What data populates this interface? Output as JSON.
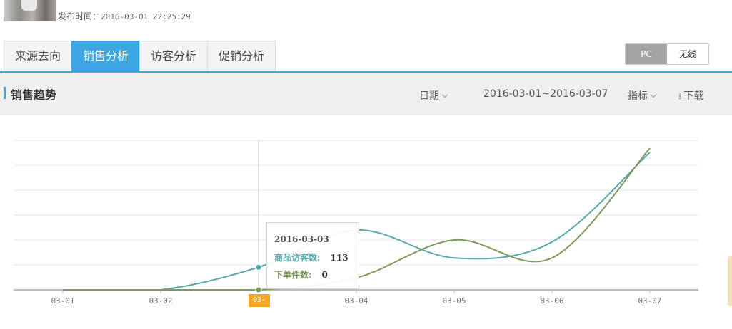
{
  "header": {
    "pubtime_label": "发布时间：",
    "pubtime_value": "2016-03-01 22:25:29"
  },
  "tabs": [
    {
      "label": "来源去向",
      "active": false
    },
    {
      "label": "销售分析",
      "active": true
    },
    {
      "label": "访客分析",
      "active": false
    },
    {
      "label": "促销分析",
      "active": false
    }
  ],
  "device_toggle": {
    "pc": "PC",
    "wireless": "无线",
    "selected": "PC"
  },
  "section": {
    "title": "销售趋势",
    "date_dropdown": "日期",
    "date_range": "2016-03-01~2016-03-07",
    "metric_dropdown": "指标",
    "download": "下载"
  },
  "colors": {
    "accent": "#3ea6e0",
    "visitors": "#57a9ae",
    "orders": "#7f9a5c",
    "highlight": "#f5a623"
  },
  "chart_data": {
    "type": "line",
    "categories": [
      "03-01",
      "03-02",
      "03-03",
      "03-04",
      "03-05",
      "03-06",
      "03-07"
    ],
    "series": [
      {
        "name": "商品访客数",
        "values": [
          0,
          0,
          113,
          300,
          160,
          240,
          690
        ]
      },
      {
        "name": "下单件数",
        "values": [
          0,
          0,
          0,
          60,
          250,
          160,
          710
        ]
      }
    ],
    "ylim": [
      0,
      750
    ],
    "grid": true,
    "tooltip": {
      "date": "2016-03-03",
      "rows": [
        {
          "label": "商品访客数:",
          "value": "113"
        },
        {
          "label": "下单件数:",
          "value": "0"
        }
      ]
    },
    "highlighted_category": "03-03"
  }
}
